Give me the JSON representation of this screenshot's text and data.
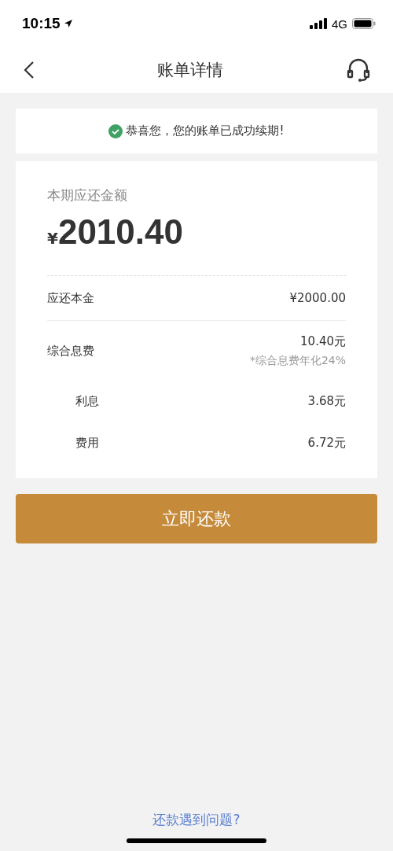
{
  "status_bar": {
    "time": "10:15",
    "network": "4G"
  },
  "nav": {
    "title": "账单详情"
  },
  "notice": {
    "text": "恭喜您，您的账单已成功续期!"
  },
  "bill": {
    "label": "本期应还金额",
    "currency": "¥",
    "amount": "2010.40",
    "rows": [
      {
        "kind": "main",
        "label": "应还本金",
        "value": "¥2000.00"
      },
      {
        "kind": "main",
        "label": "综合息费",
        "value": "10.40元",
        "note": "*综合息费年化24%"
      },
      {
        "kind": "sub",
        "label": "利息",
        "value": "3.68元"
      },
      {
        "kind": "sub",
        "label": "费用",
        "value": "6.72元"
      }
    ]
  },
  "primary_button": {
    "label": "立即还款"
  },
  "help_link": {
    "label": "还款遇到问题?"
  }
}
